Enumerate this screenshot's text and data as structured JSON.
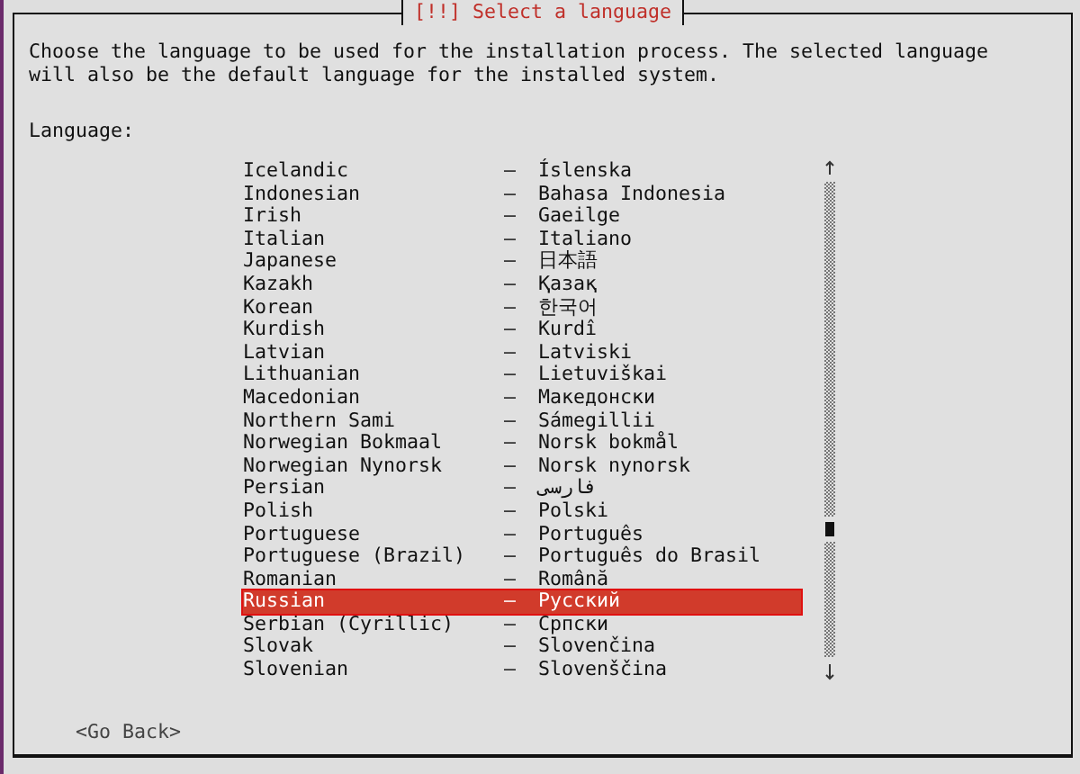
{
  "dialog": {
    "title": "[!!] Select a language"
  },
  "description": "Choose the language to be used for the installation process. The selected language will also be the default language for the installed system.",
  "list_label": "Language:",
  "languages": [
    {
      "name": "Icelandic",
      "separator": "–",
      "native": "Íslenska",
      "selected": false
    },
    {
      "name": "Indonesian",
      "separator": "–",
      "native": "Bahasa Indonesia",
      "selected": false
    },
    {
      "name": "Irish",
      "separator": "–",
      "native": "Gaeilge",
      "selected": false
    },
    {
      "name": "Italian",
      "separator": "–",
      "native": "Italiano",
      "selected": false
    },
    {
      "name": "Japanese",
      "separator": "–",
      "native": "日本語",
      "selected": false
    },
    {
      "name": "Kazakh",
      "separator": "–",
      "native": "Қазақ",
      "selected": false
    },
    {
      "name": "Korean",
      "separator": "–",
      "native": "한국어",
      "selected": false
    },
    {
      "name": "Kurdish",
      "separator": "–",
      "native": "Kurdî",
      "selected": false
    },
    {
      "name": "Latvian",
      "separator": "–",
      "native": "Latviski",
      "selected": false
    },
    {
      "name": "Lithuanian",
      "separator": "–",
      "native": "Lietuviškai",
      "selected": false
    },
    {
      "name": "Macedonian",
      "separator": "–",
      "native": "Македонски",
      "selected": false
    },
    {
      "name": "Northern Sami",
      "separator": "–",
      "native": "Sámegillii",
      "selected": false
    },
    {
      "name": "Norwegian Bokmaal",
      "separator": "–",
      "native": "Norsk bokmål",
      "selected": false
    },
    {
      "name": "Norwegian Nynorsk",
      "separator": "–",
      "native": "Norsk nynorsk",
      "selected": false
    },
    {
      "name": "Persian",
      "separator": "–",
      "native": "فارسی",
      "selected": false
    },
    {
      "name": "Polish",
      "separator": "–",
      "native": "Polski",
      "selected": false
    },
    {
      "name": "Portuguese",
      "separator": "–",
      "native": "Português",
      "selected": false
    },
    {
      "name": "Portuguese (Brazil)",
      "separator": "–",
      "native": "Português do Brasil",
      "selected": false
    },
    {
      "name": "Romanian",
      "separator": "–",
      "native": "Română",
      "selected": false
    },
    {
      "name": "Russian",
      "separator": "–",
      "native": "Русский",
      "selected": true
    },
    {
      "name": "Serbian (Cyrillic)",
      "separator": "–",
      "native": "Српски",
      "selected": false
    },
    {
      "name": "Slovak",
      "separator": "–",
      "native": "Slovenčina",
      "selected": false
    },
    {
      "name": "Slovenian",
      "separator": "–",
      "native": "Slovenščina",
      "selected": false
    }
  ],
  "back_button": "<Go Back>"
}
